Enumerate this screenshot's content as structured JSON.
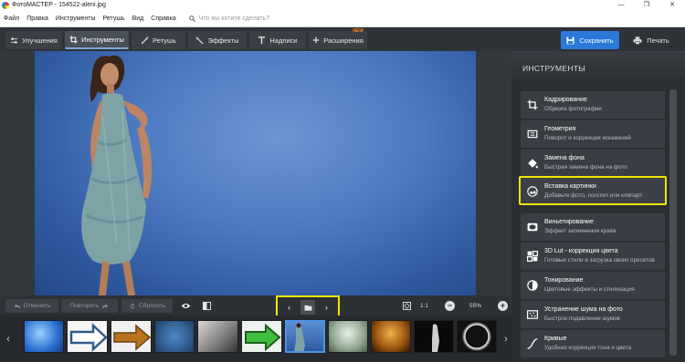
{
  "window": {
    "title": "ФотоМАСТЕР - 154522-aleni.jpg",
    "minimize": "—",
    "maximize": "❐",
    "close": "✕"
  },
  "menu": {
    "items": [
      "Файл",
      "Правка",
      "Инструменты",
      "Ретушь",
      "Вид",
      "Справка"
    ],
    "search_placeholder": "Что вы хотите сделать?"
  },
  "toolbar": {
    "tabs": [
      {
        "label": "Улучшения",
        "icon": "sliders-icon"
      },
      {
        "label": "Инструменты",
        "icon": "crop-icon",
        "active": true
      },
      {
        "label": "Ретушь",
        "icon": "brush-icon"
      },
      {
        "label": "Эффекты",
        "icon": "magic-wand-icon"
      },
      {
        "label": "Надписи",
        "icon": "text-icon"
      },
      {
        "label": "Расширения",
        "icon": "plus-icon",
        "badge": "NEW"
      }
    ],
    "save_label": "Сохранить",
    "print_label": "Печать"
  },
  "controls": {
    "undo_label": "Отменить",
    "redo_label": "Повторить",
    "reset_label": "Сбросить",
    "prev": "‹",
    "next": "›",
    "actual_size_label": "1:1",
    "zoom_minus": "−",
    "zoom_plus": "+",
    "zoom_value": "55%"
  },
  "filmstrip": {
    "prev": "‹",
    "next": "›",
    "selected_index": 6,
    "count": 11
  },
  "panel": {
    "title": "ИНСТРУМЕНТЫ",
    "tools": [
      {
        "name": "Кадрирование",
        "desc": "Обрезка фотографии",
        "icon": "crop-icon"
      },
      {
        "name": "Геометрия",
        "desc": "Поворот и коррекция искажений",
        "icon": "geometry-icon"
      },
      {
        "name": "Замена фона",
        "desc": "Быстрая замена фона на фото",
        "icon": "paint-bucket-icon"
      },
      {
        "name": "Вставка картинки",
        "desc": "Добавьте фото, логотип или клипарт",
        "icon": "insert-image-icon",
        "highlighted": true
      },
      {
        "name": "Виньетирование",
        "desc": "Эффект затемнения краёв",
        "icon": "vignette-icon"
      },
      {
        "name": "3D Lut - коррекция цвета",
        "desc": "Готовые стили и загрузка своих пресетов",
        "icon": "lut-icon"
      },
      {
        "name": "Тонирование",
        "desc": "Цветовые эффекты и стилизация",
        "icon": "toning-icon"
      },
      {
        "name": "Устранение шума на фото",
        "desc": "Быстрое подавление шумов",
        "icon": "denoise-icon"
      },
      {
        "name": "Кривые",
        "desc": "Удобная коррекция тона и цвета",
        "icon": "curves-icon"
      }
    ]
  },
  "colors": {
    "accent": "#2979d8",
    "highlight": "#f2e600",
    "new_badge": "#ff8a1e"
  }
}
